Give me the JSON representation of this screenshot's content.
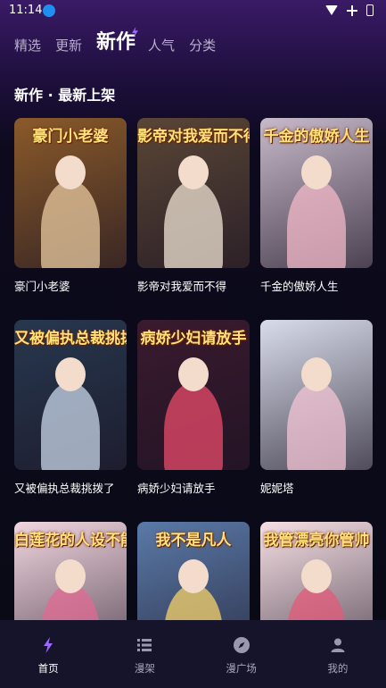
{
  "status": {
    "time": "11:14"
  },
  "tabs": [
    {
      "label": "精选",
      "active": false
    },
    {
      "label": "更新",
      "active": false
    },
    {
      "label": "新作",
      "active": true
    },
    {
      "label": "人气",
      "active": false
    },
    {
      "label": "分类",
      "active": false
    }
  ],
  "section": {
    "title": "新作 · 最新上架"
  },
  "comics": [
    {
      "name": "豪门小老婆",
      "cover_title": "豪门小老婆",
      "bg": "#8a5a2a",
      "accent": "#e8c9a0"
    },
    {
      "name": "影帝对我爱而不得",
      "cover_title": "影帝对我爱而不得",
      "bg": "#5a4636",
      "accent": "#f0e4d4"
    },
    {
      "name": "千金的傲娇人生",
      "cover_title": "千金的傲娇人生",
      "bg": "#c7b9c9",
      "accent": "#f2b8c8"
    },
    {
      "name": "又被偏执总裁挑拨了",
      "cover_title": "又被偏执总裁挑拨了",
      "bg": "#27384f",
      "accent": "#c9d7ea"
    },
    {
      "name": "病娇少妇请放手",
      "cover_title": "病娇少妇请放手",
      "bg": "#3a1a2e",
      "accent": "#e94b6b"
    },
    {
      "name": "妮妮塔",
      "cover_title": "",
      "bg": "#d8dcea",
      "accent": "#f3c4d4"
    },
    {
      "name": "",
      "cover_title": "白莲花的人设不能崩",
      "bg": "#f2d6df",
      "accent": "#e06a92"
    },
    {
      "name": "",
      "cover_title": "我不是凡人",
      "bg": "#5a7aa8",
      "accent": "#f5d26a"
    },
    {
      "name": "",
      "cover_title": "我管漂亮你管帅",
      "bg": "#f6dfe4",
      "accent": "#e35a7a"
    }
  ],
  "nav": [
    {
      "label": "首页",
      "icon": "bolt-icon",
      "active": true
    },
    {
      "label": "漫架",
      "icon": "list-icon",
      "active": false
    },
    {
      "label": "漫广场",
      "icon": "compass-icon",
      "active": false
    },
    {
      "label": "我的",
      "icon": "user-icon",
      "active": false
    }
  ]
}
